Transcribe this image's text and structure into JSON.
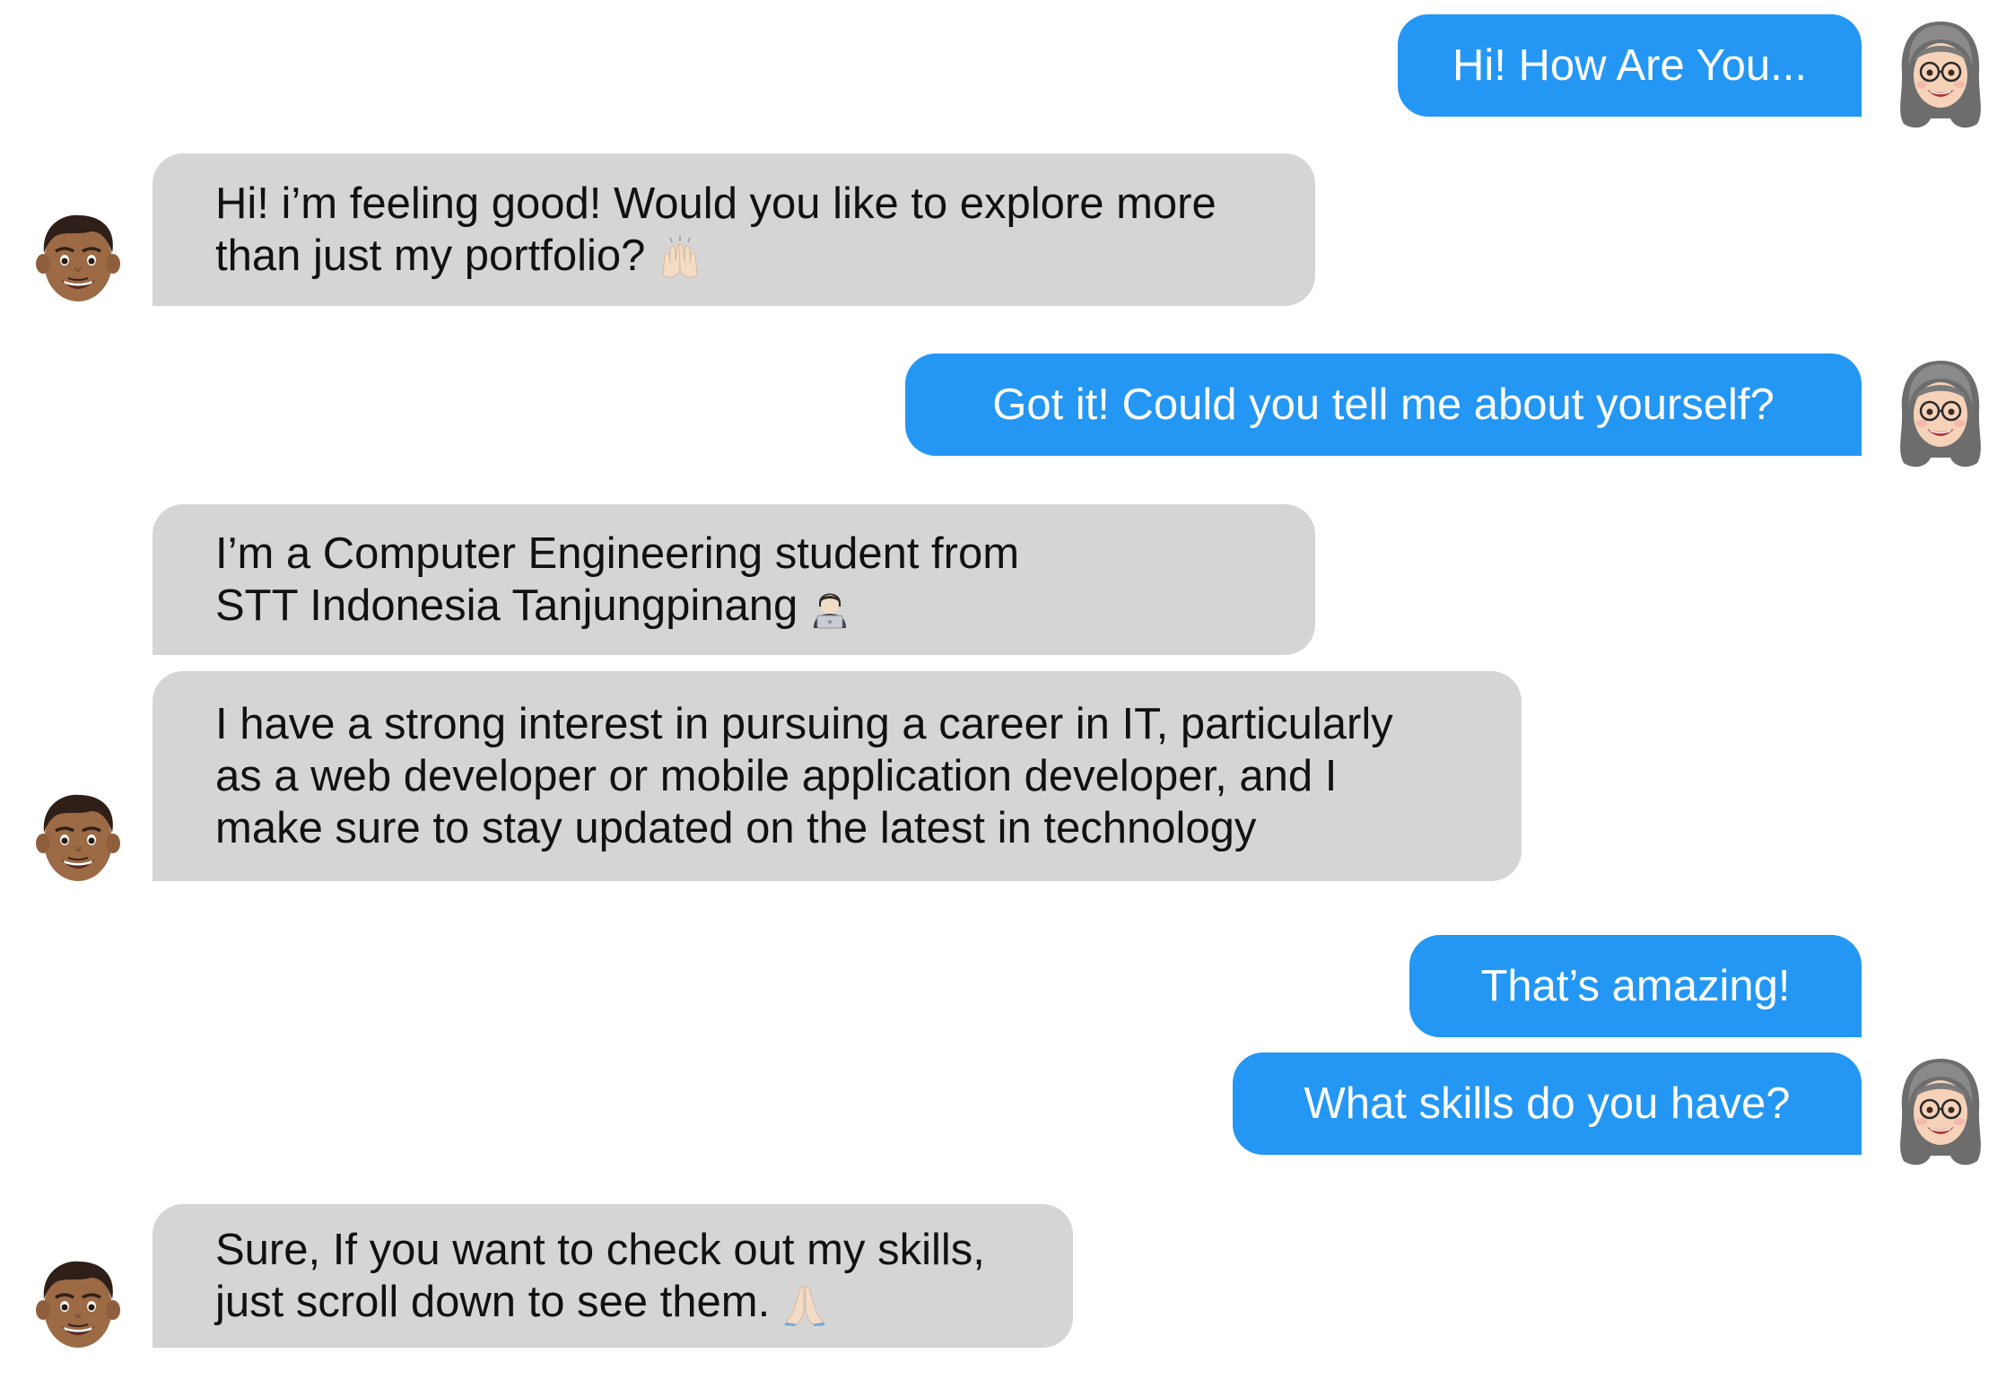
{
  "colors": {
    "outgoing_bubble": "#2397f3",
    "incoming_bubble": "#d5d5d5",
    "outgoing_text": "#ffffff",
    "incoming_text": "#111111"
  },
  "messages": [
    {
      "sender": "visitor",
      "lines": [
        "Hi! How Are You..."
      ]
    },
    {
      "sender": "owner",
      "lines": [
        "Hi! i’m feeling good! Would you like to explore more",
        "than just my portfolio?"
      ],
      "emoji": "raising-hands"
    },
    {
      "sender": "visitor",
      "lines": [
        "Got it! Could you tell me about yourself?"
      ]
    },
    {
      "sender": "owner",
      "lines": [
        "I’m a Computer Engineering student from",
        "STT Indonesia Tanjungpinang"
      ],
      "emoji": "technologist"
    },
    {
      "sender": "owner",
      "lines": [
        "I have a strong interest in pursuing a career in IT, particularly",
        "as a web developer or mobile application developer, and I",
        "make sure to stay updated on the latest in technology"
      ]
    },
    {
      "sender": "visitor",
      "lines": [
        "That’s amazing!"
      ]
    },
    {
      "sender": "visitor",
      "lines": [
        "What skills do you have?"
      ]
    },
    {
      "sender": "owner",
      "lines": [
        "Sure, If you want to check out my skills,",
        "just scroll down to see them."
      ],
      "emoji": "folded-hands"
    }
  ],
  "avatars": {
    "visitor": "memoji-woman-glasses-avatar",
    "owner": "memoji-man-avatar"
  }
}
